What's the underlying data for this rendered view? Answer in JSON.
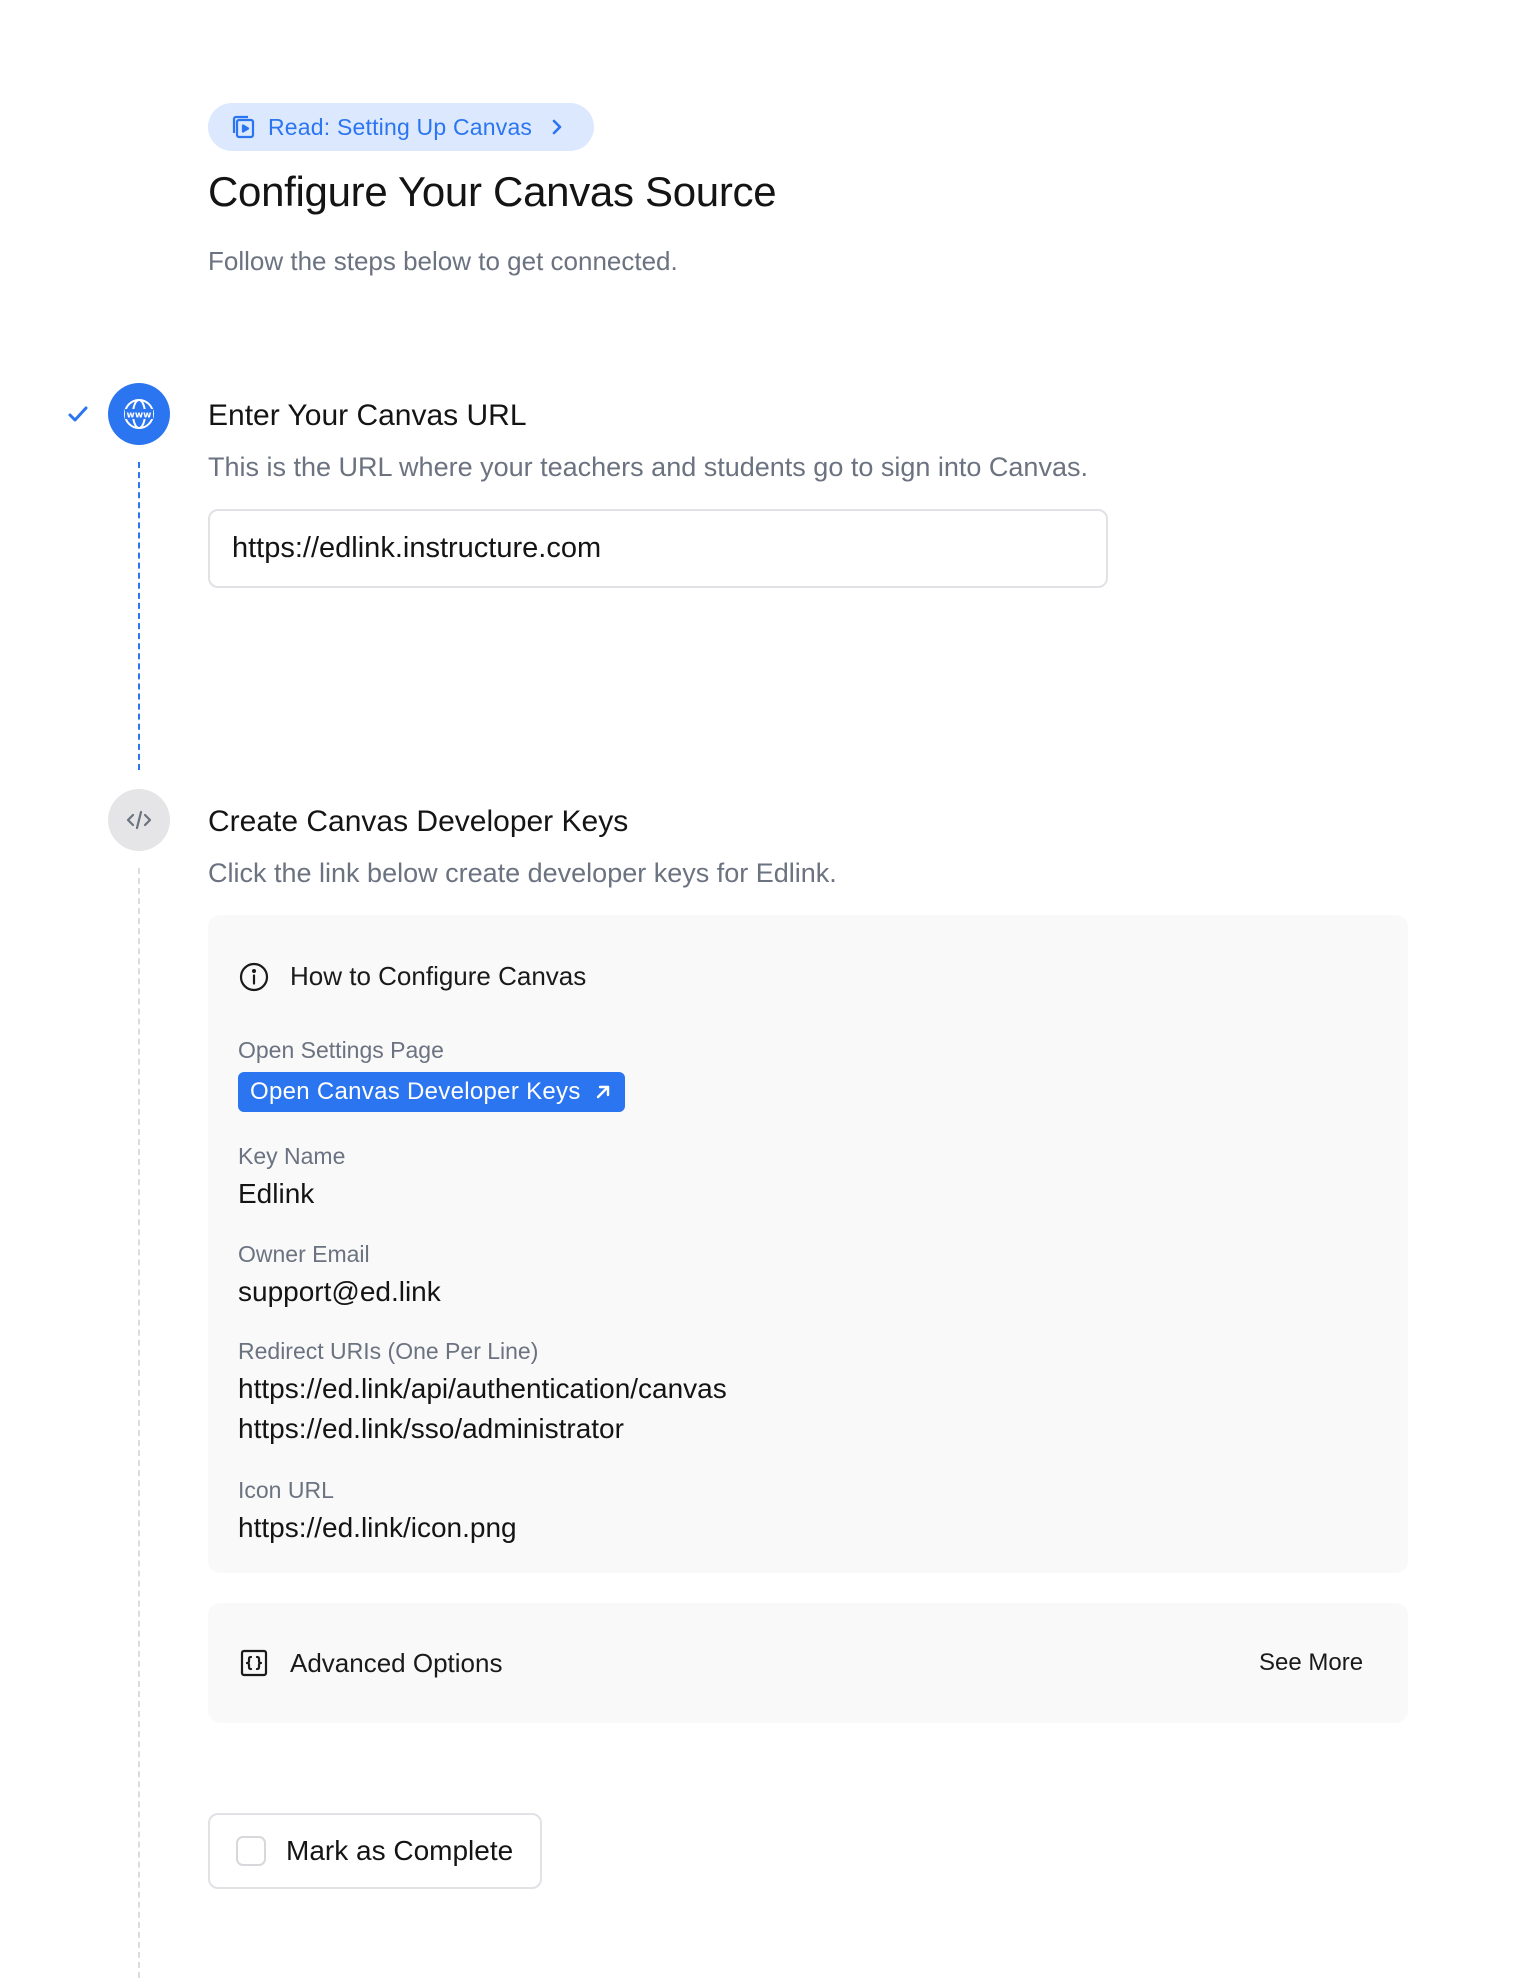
{
  "header": {
    "read_link_label": "Read: Setting Up Canvas",
    "title": "Configure Your Canvas Source",
    "subtitle": "Follow the steps below to get connected."
  },
  "steps": [
    {
      "title": "Enter Your Canvas URL",
      "description": "This is the URL where your teachers and students go to sign into Canvas.",
      "status": "complete",
      "icon": "www-globe-icon",
      "input_value": "https://edlink.instructure.com"
    },
    {
      "title": "Create Canvas Developer Keys",
      "description": "Click the link below create developer keys for Edlink.",
      "status": "pending",
      "icon": "code-icon"
    }
  ],
  "config_card": {
    "heading": "How to Configure Canvas",
    "open_settings_label": "Open Settings Page",
    "open_button_label": "Open Canvas Developer Keys",
    "key_name_label": "Key Name",
    "key_name_value": "Edlink",
    "owner_email_label": "Owner Email",
    "owner_email_value": "support@ed.link",
    "redirect_label": "Redirect URIs (One Per Line)",
    "redirect_values": [
      "https://ed.link/api/authentication/canvas",
      "https://ed.link/sso/administrator"
    ],
    "icon_url_label": "Icon URL",
    "icon_url_value": "https://ed.link/icon.png"
  },
  "advanced": {
    "label": "Advanced Options",
    "see_more_label": "See More"
  },
  "complete": {
    "label": "Mark as Complete",
    "checked": false
  },
  "colors": {
    "accent": "#2b75f0",
    "accent_light": "#dbe8fe",
    "muted_text": "#6b7280",
    "card_bg": "#f9f9fa"
  }
}
